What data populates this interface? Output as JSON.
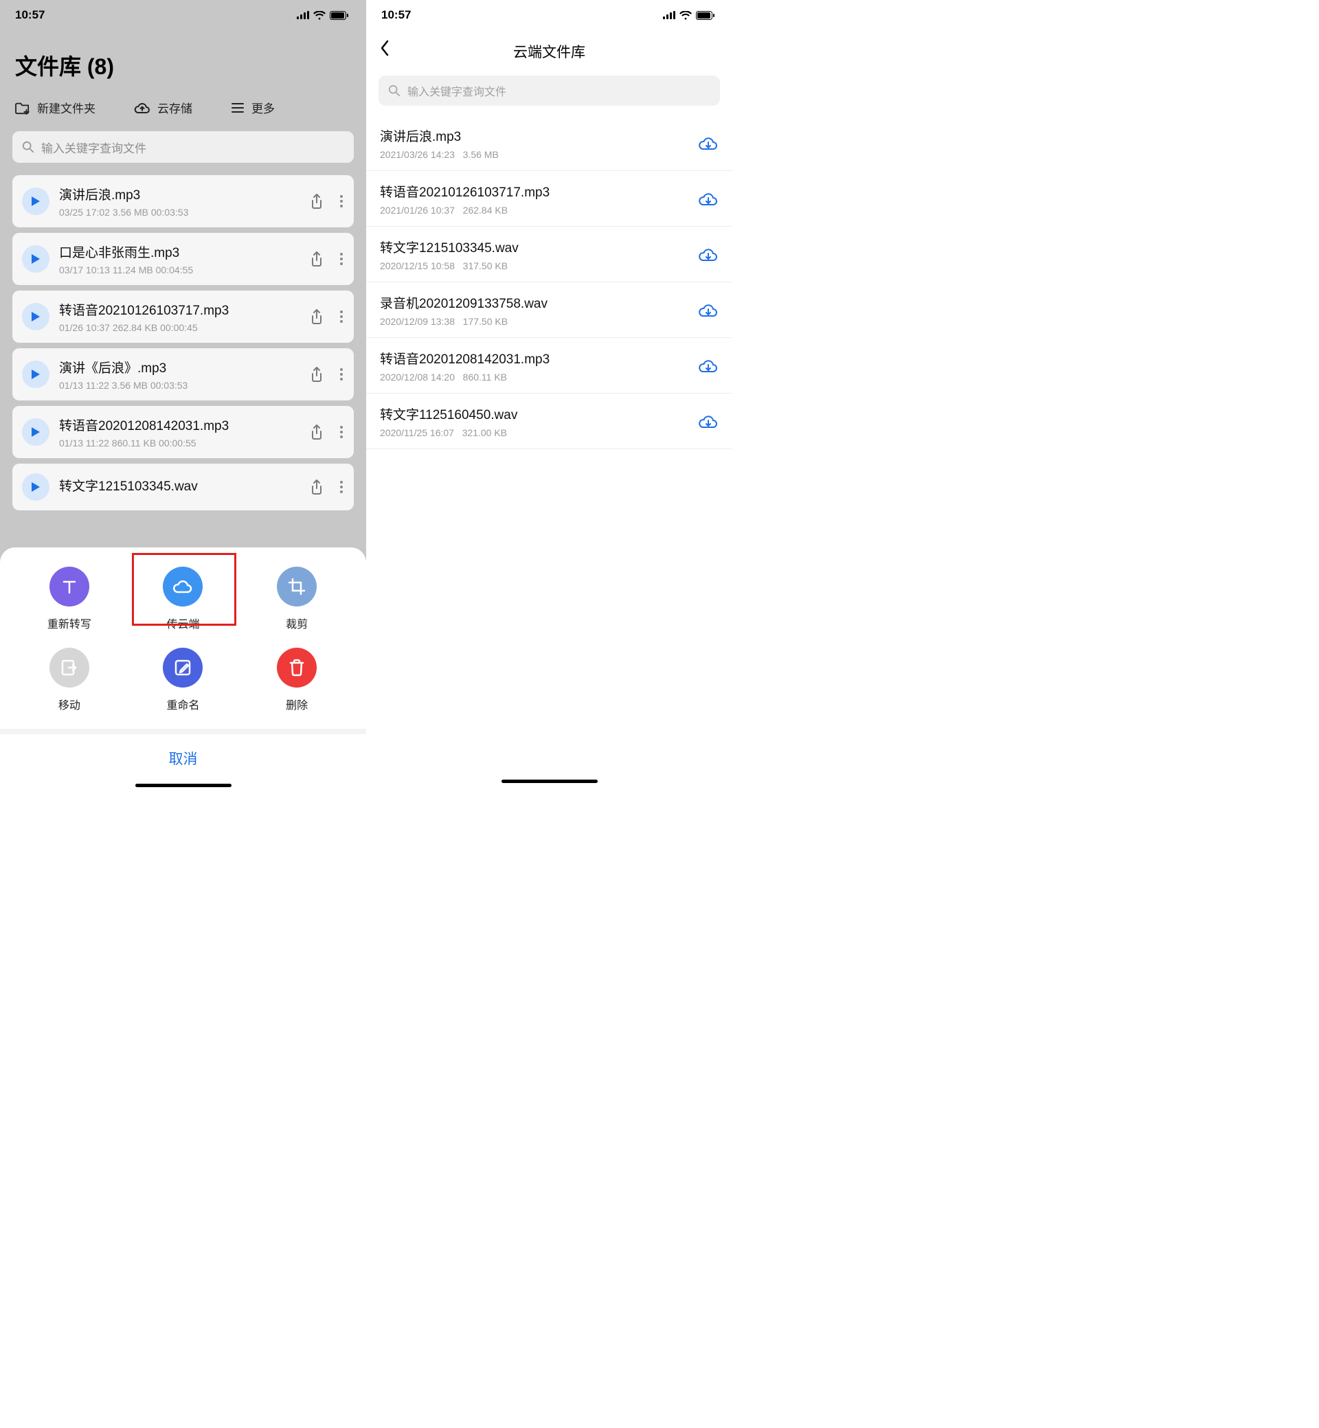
{
  "left": {
    "status": {
      "time": "10:57"
    },
    "title": "文件库 (8)",
    "toolbar": {
      "new_folder": "新建文件夹",
      "cloud": "云存储",
      "more": "更多"
    },
    "search_placeholder": "输入关键字查询文件",
    "files": [
      {
        "name": "演讲后浪.mp3",
        "meta": "03/25 17:02  3.56 MB  00:03:53"
      },
      {
        "name": "口是心非张雨生.mp3",
        "meta": "03/17 10:13  11.24 MB  00:04:55"
      },
      {
        "name": "转语音20210126103717.mp3",
        "meta": "01/26 10:37  262.84 KB  00:00:45"
      },
      {
        "name": "演讲《后浪》.mp3",
        "meta": "01/13 11:22  3.56 MB  00:03:53"
      },
      {
        "name": "转语音20201208142031.mp3",
        "meta": "01/13 11:22  860.11 KB  00:00:55"
      },
      {
        "name": "转文字1215103345.wav",
        "meta": ""
      }
    ],
    "sheet": {
      "actions": [
        {
          "label": "重新转写",
          "icon": "text"
        },
        {
          "label": "传云端",
          "icon": "cloud"
        },
        {
          "label": "裁剪",
          "icon": "crop"
        },
        {
          "label": "移动",
          "icon": "move"
        },
        {
          "label": "重命名",
          "icon": "rename"
        },
        {
          "label": "删除",
          "icon": "trash"
        }
      ],
      "cancel": "取消"
    }
  },
  "right": {
    "status": {
      "time": "10:57"
    },
    "title": "云端文件库",
    "search_placeholder": "输入关键字查询文件",
    "files": [
      {
        "name": "演讲后浪.mp3",
        "date": "2021/03/26 14:23",
        "size": "3.56 MB"
      },
      {
        "name": "转语音20210126103717.mp3",
        "date": "2021/01/26 10:37",
        "size": "262.84 KB"
      },
      {
        "name": "转文字1215103345.wav",
        "date": "2020/12/15 10:58",
        "size": "317.50 KB"
      },
      {
        "name": "录音机20201209133758.wav",
        "date": "2020/12/09 13:38",
        "size": "177.50 KB"
      },
      {
        "name": "转语音20201208142031.mp3",
        "date": "2020/12/08 14:20",
        "size": "860.11 KB"
      },
      {
        "name": "转文字1125160450.wav",
        "date": "2020/11/25 16:07",
        "size": "321.00 KB"
      }
    ]
  }
}
